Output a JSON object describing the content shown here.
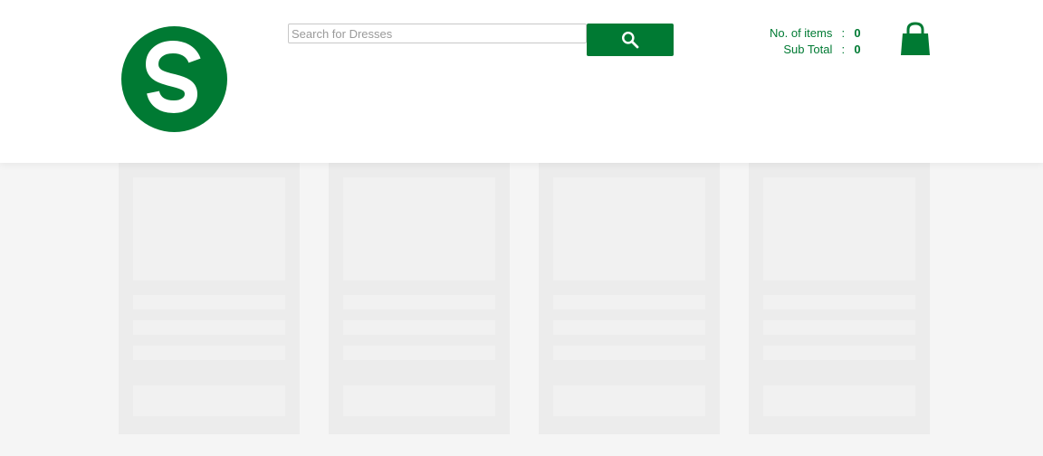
{
  "search": {
    "placeholder": "Search for Dresses"
  },
  "cart": {
    "items_label": "No. of items",
    "items_sep": ":",
    "items_value": "0",
    "subtotal_label": "Sub Total",
    "subtotal_sep": ":",
    "subtotal_value": "0"
  },
  "icons": {
    "logo": "s-logo",
    "search": "search-icon",
    "cart": "shopping-bag-icon"
  },
  "colors": {
    "brand": "#007a33",
    "page_bg": "#f5f5f5",
    "skeleton_card": "#ececec",
    "skeleton_block": "#f1f1f1"
  },
  "products": [
    {
      "state": "loading"
    },
    {
      "state": "loading"
    },
    {
      "state": "loading"
    },
    {
      "state": "loading"
    }
  ]
}
